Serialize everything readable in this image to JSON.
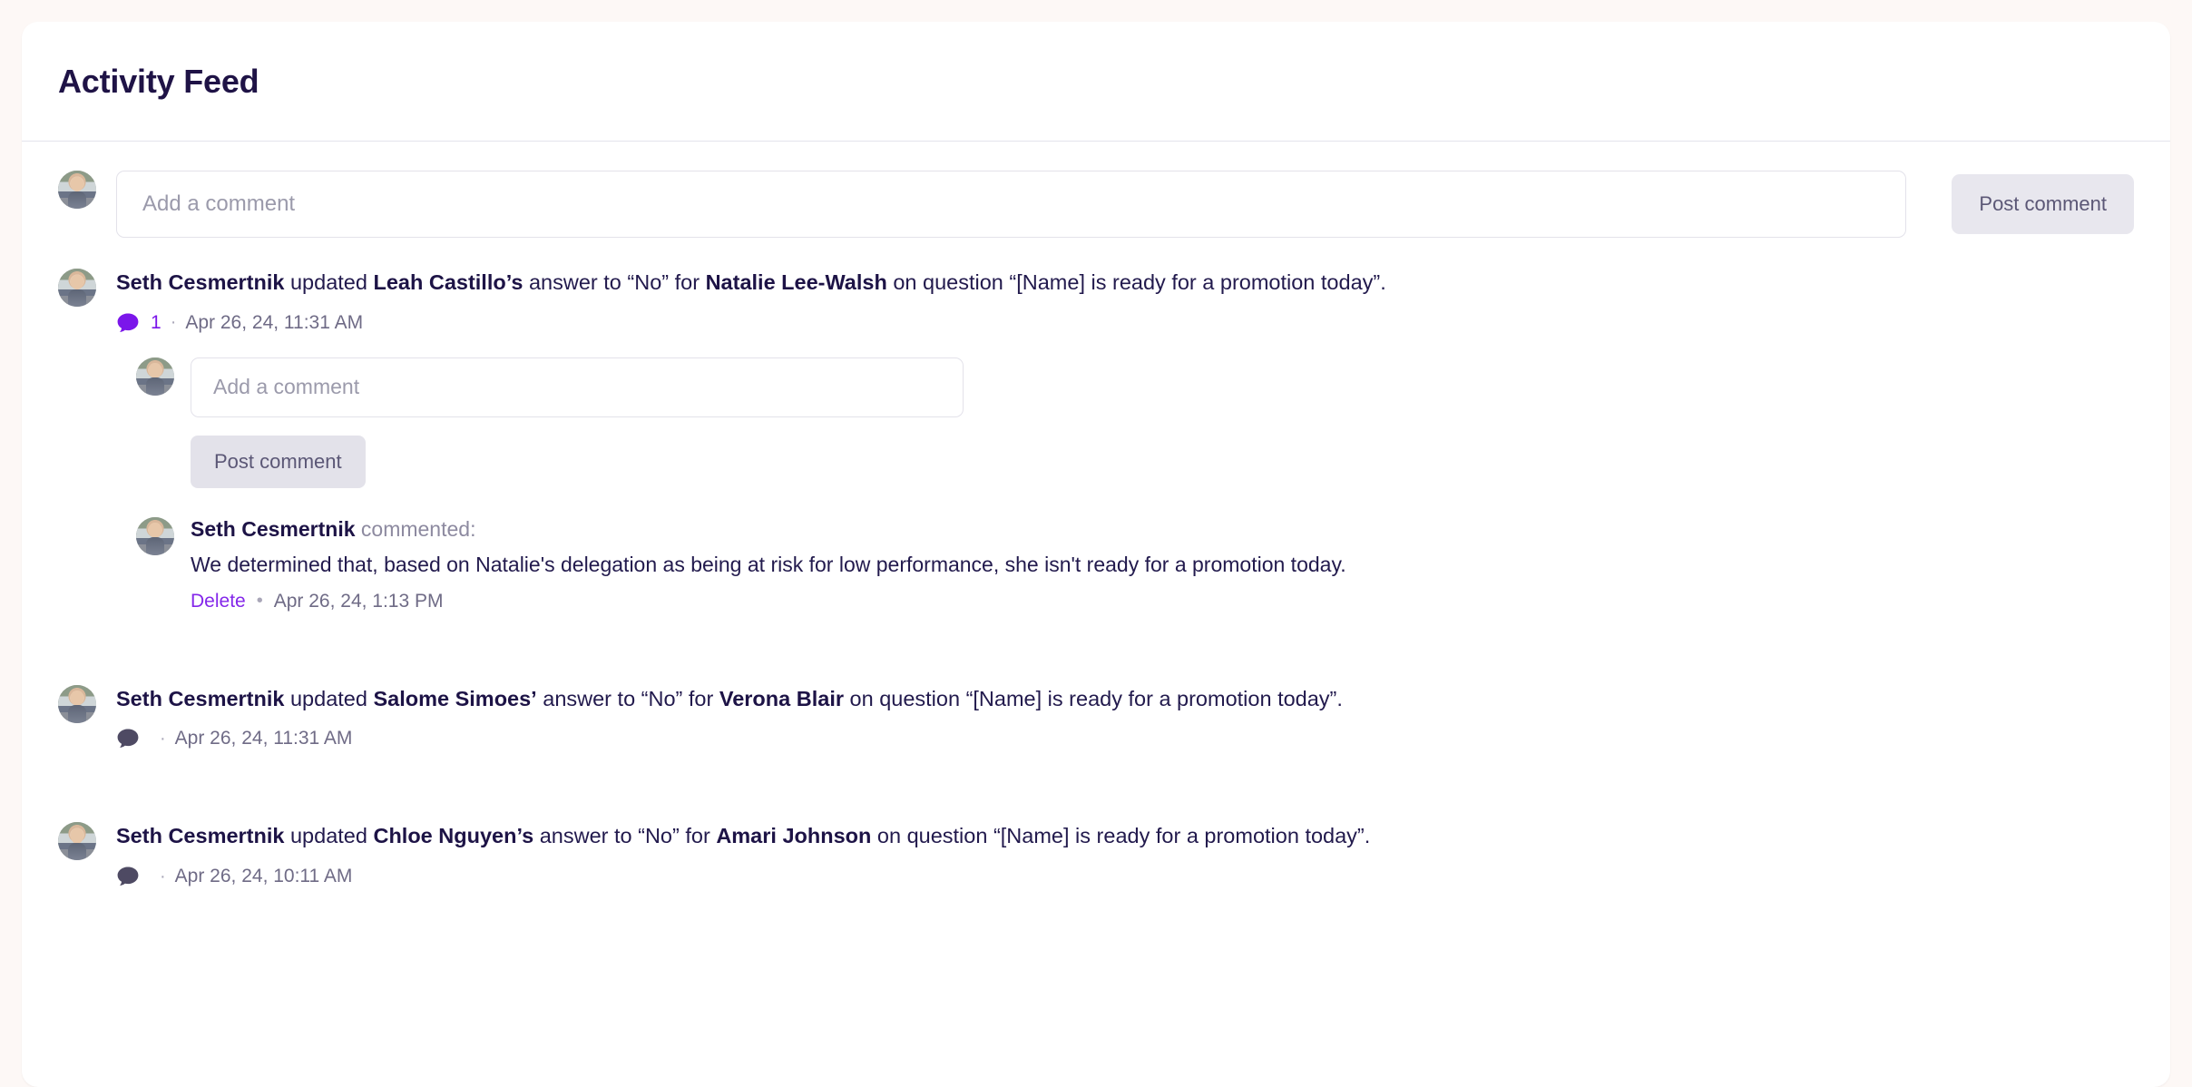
{
  "page": {
    "title": "Activity Feed",
    "background_color": "#fdf8f6",
    "card_color": "#ffffff",
    "accent_purple": "#7b16ea",
    "title_color": "#1f1346"
  },
  "composer": {
    "placeholder": "Add a comment",
    "value": "",
    "post_label": "Post comment",
    "avatar_name": "user-avatar"
  },
  "activities": [
    {
      "actor": "Seth Cesmertnik",
      "verb": "updated",
      "subject": "Leah Castillo’s",
      "middle": "answer to “No” for",
      "target": "Natalie Lee-Walsh",
      "tail": "on question “[Name] is ready for a promotion today”.",
      "comment_count": "1",
      "separator": "·",
      "timestamp": "Apr 26, 24, 11:31 AM",
      "icon_active": true,
      "thread": {
        "placeholder": "Add a comment",
        "value": "",
        "post_label": "Post comment",
        "comments": [
          {
            "author": "Seth Cesmertnik",
            "action": "commented:",
            "body": "We determined that, based on Natalie's delegation as being at risk for low performance, she isn't ready for a promotion today.",
            "delete_label": "Delete",
            "separator": "•",
            "timestamp": "Apr 26, 24, 1:13 PM"
          }
        ]
      }
    },
    {
      "actor": "Seth Cesmertnik",
      "verb": "updated",
      "subject": "Salome Simoes’",
      "middle": "answer to “No” for",
      "target": "Verona Blair",
      "tail": "on question “[Name] is ready for a promotion today”.",
      "comment_count": "",
      "separator": "·",
      "timestamp": "Apr 26, 24, 11:31 AM",
      "icon_active": false,
      "thread": null
    },
    {
      "actor": "Seth Cesmertnik",
      "verb": "updated",
      "subject": "Chloe Nguyen’s",
      "middle": "answer to “No” for",
      "target": "Amari Johnson",
      "tail": "on question “[Name] is ready for a promotion today”.",
      "comment_count": "",
      "separator": "·",
      "timestamp": "Apr 26, 24, 10:11 AM",
      "icon_active": false,
      "thread": null
    }
  ],
  "icons": {
    "comment_bubble": "comment-bubble-icon"
  }
}
